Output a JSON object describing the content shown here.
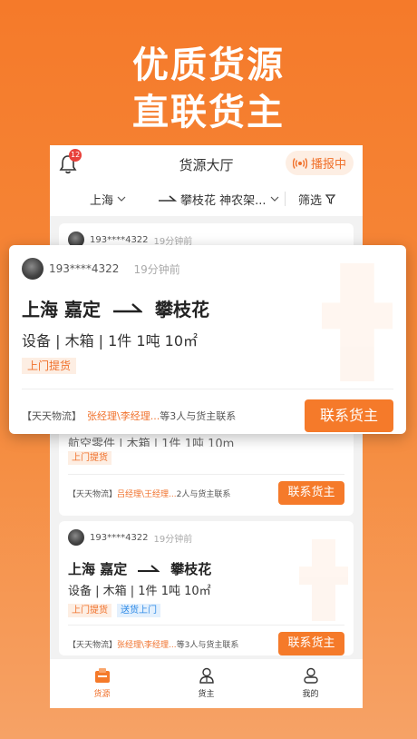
{
  "headline": {
    "line1": "优质货源",
    "line2": "直联货主"
  },
  "header": {
    "notification_count": "12",
    "title": "货源大厅",
    "broadcast_label": "播报中"
  },
  "filters": {
    "origin": "上海",
    "destination": "攀枝花 神农架...",
    "filter_label": "筛选"
  },
  "cards": [
    {
      "phone": "193****4322",
      "time_ago": "19分钟前",
      "spec": "航空零件 | 木箱 | 1件  1吨    10m",
      "tags": [
        "上门提货"
      ],
      "company": "【天天物流】",
      "contacts": "吕经理\\王经理...",
      "contact_suffix": "2人与货主联系",
      "contact_button": "联系货主"
    },
    {
      "phone": "193****4322",
      "time_ago": "19分钟前",
      "origin": "上海 嘉定",
      "destination": "攀枝花",
      "spec": "设备 | 木箱 | 1件  1吨    10㎡",
      "tags": [
        "上门提货",
        "送货上门"
      ],
      "company": "【天天物流】",
      "contacts": "张经理\\李经理...",
      "contact_suffix": "等3人与货主联系",
      "contact_button": "联系货主"
    }
  ],
  "popup": {
    "phone": "193****4322",
    "time_ago": "19分钟前",
    "origin": "上海 嘉定",
    "destination": "攀枝花",
    "spec": "设备 | 木箱 | 1件  1吨    10㎡",
    "tags": [
      "上门提货"
    ],
    "company": "【天天物流】",
    "contacts": "张经理\\李经理...",
    "contact_suffix": "等3人与货主联系",
    "contact_button": "联系货主"
  },
  "bottom_nav": [
    {
      "label": "货源",
      "icon": "cargo-box-icon",
      "active": true
    },
    {
      "label": "货主",
      "icon": "shipper-person-icon",
      "active": false
    },
    {
      "label": "我的",
      "icon": "profile-icon",
      "active": false
    }
  ],
  "colors": {
    "brand_orange": "#f57a2a",
    "tag_orange_bg": "#fdeee3",
    "tag_blue_text": "#2e8ae6",
    "badge_red": "#e8403a"
  }
}
